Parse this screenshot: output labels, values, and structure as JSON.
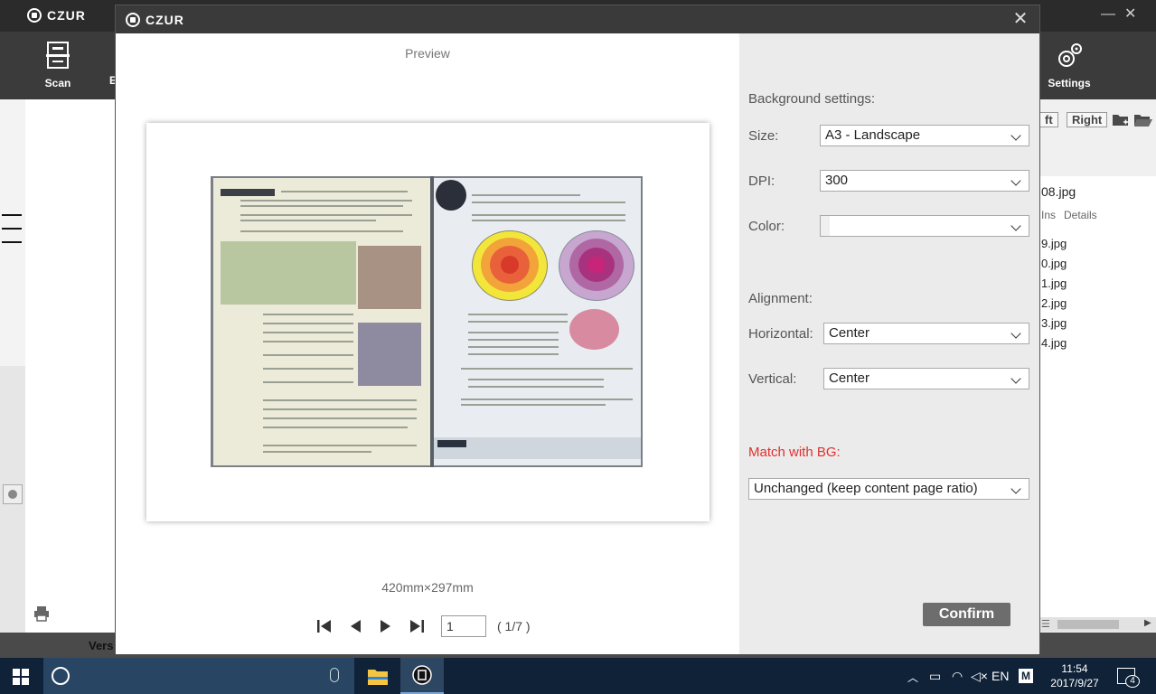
{
  "app": {
    "brand": "CZUR",
    "toolbar": {
      "scan_label": "Scan",
      "partial_label": "E",
      "settings_label": "Settings"
    },
    "right_panel": {
      "left_btn_partial": "ft",
      "right_btn": "Right",
      "selected_file_partial": "08.jpg",
      "col_ins": "Ins",
      "col_details": "Details",
      "files": [
        "9.jpg",
        "0.jpg",
        "1.jpg",
        "2.jpg",
        "3.jpg",
        "4.jpg"
      ]
    },
    "status_partial": "Vers"
  },
  "dialog": {
    "brand": "CZUR",
    "close_glyph": "✕",
    "preview_label": "Preview",
    "page_size": "420mm×297mm",
    "nav": {
      "current_page": "1",
      "total": "( 1/7 )"
    },
    "settings": {
      "background_heading": "Background settings:",
      "size_label": "Size:",
      "size_value": "A3 - Landscape",
      "dpi_label": "DPI:",
      "dpi_value": "300",
      "color_label": "Color:",
      "color_value": "",
      "alignment_heading": "Alignment:",
      "horizontal_label": "Horizontal:",
      "horizontal_value": "Center",
      "vertical_label": "Vertical:",
      "vertical_value": "Center",
      "match_bg_label": "Match with BG:",
      "match_bg_value": "Unchanged (keep content page ratio)",
      "confirm_label": "Confirm"
    }
  },
  "taskbar": {
    "language": "EN",
    "ime": "M",
    "time": "11:54",
    "date": "2017/9/27",
    "notification_count": "4"
  },
  "colors": {
    "accent_red": "#e0302e",
    "titlebar": "#2b2b2b",
    "toolbar": "#3b3b3b",
    "confirm_bg": "#6d6d6d",
    "taskbar": "#102238"
  }
}
